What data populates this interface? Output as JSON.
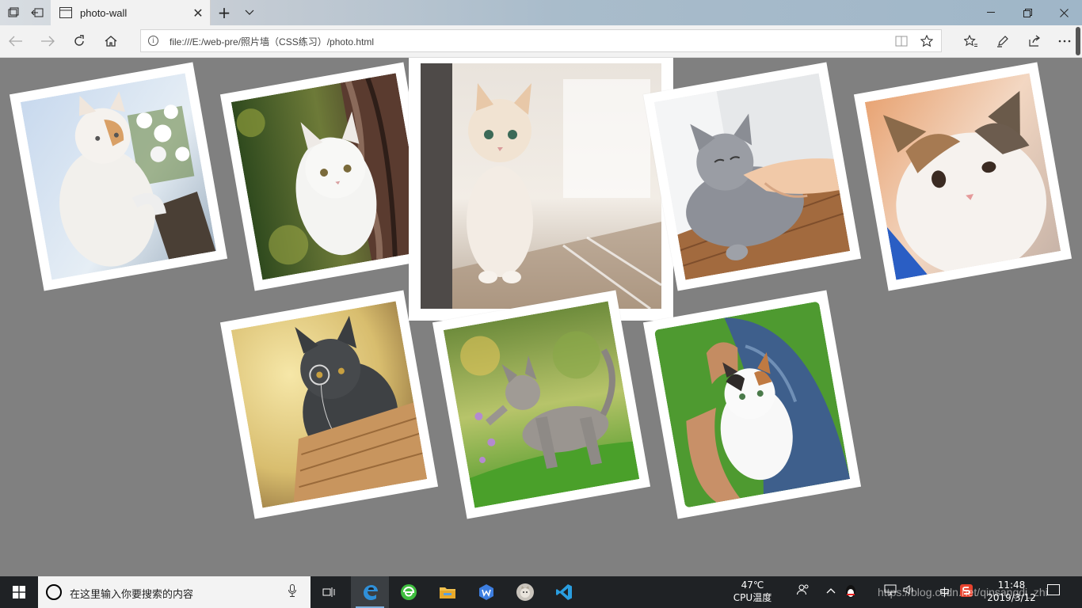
{
  "browser": {
    "tab_title": "photo-wall",
    "url": "file:///E:/web-pre/照片墙（CSS练习）/photo.html",
    "icons": {
      "tab_actions": "tab-list-icon",
      "set_aside": "set-aside-tabs-icon",
      "back": "back-arrow-icon",
      "forward": "forward-arrow-icon",
      "refresh": "refresh-icon",
      "home": "home-icon",
      "reading_view": "reading-view-icon",
      "favorite": "star-icon",
      "favorites_hub": "favorites-icon",
      "notes": "pen-icon",
      "share": "share-icon",
      "more": "more-icon"
    }
  },
  "page": {
    "background": "#808080",
    "photos": [
      {
        "name": "photo-cat-flowers",
        "subject": "white and orange kitten with white flowers in a pot",
        "rotation_deg": -10
      },
      {
        "name": "photo-cat-tree",
        "subject": "white kitten peeking from behind a tree trunk",
        "rotation_deg": -10
      },
      {
        "name": "photo-cat-sitting",
        "subject": "cream kitten sitting on wooden floor",
        "rotation_deg": 0
      },
      {
        "name": "photo-grey-cat-hand",
        "subject": "grey cat being petted by a hand",
        "rotation_deg": -10
      },
      {
        "name": "photo-cat-closeup",
        "subject": "calico kitten close-up face",
        "rotation_deg": -10
      },
      {
        "name": "photo-cat-monocle",
        "subject": "grey cat with monocle in a box",
        "rotation_deg": -10
      },
      {
        "name": "photo-cat-grass",
        "subject": "tabby kitten playing on grass",
        "rotation_deg": -10
      },
      {
        "name": "photo-cat-lap",
        "subject": "white calico kitten lying on a lap",
        "rotation_deg": -10
      }
    ]
  },
  "taskbar": {
    "search_placeholder": "在这里输入你要搜索的内容",
    "cpu_temp": "47℃",
    "cpu_label": "CPU温度",
    "ime": "中",
    "time": "11:48",
    "date": "2019/3/12",
    "watermark": "https://blog.csdn.net/qinsangdi_zhi",
    "apps": [
      "task-view-icon",
      "edge-icon",
      "browser-360-icon",
      "file-explorer-icon",
      "wps-icon",
      "photo-app-icon",
      "vscode-icon"
    ]
  }
}
